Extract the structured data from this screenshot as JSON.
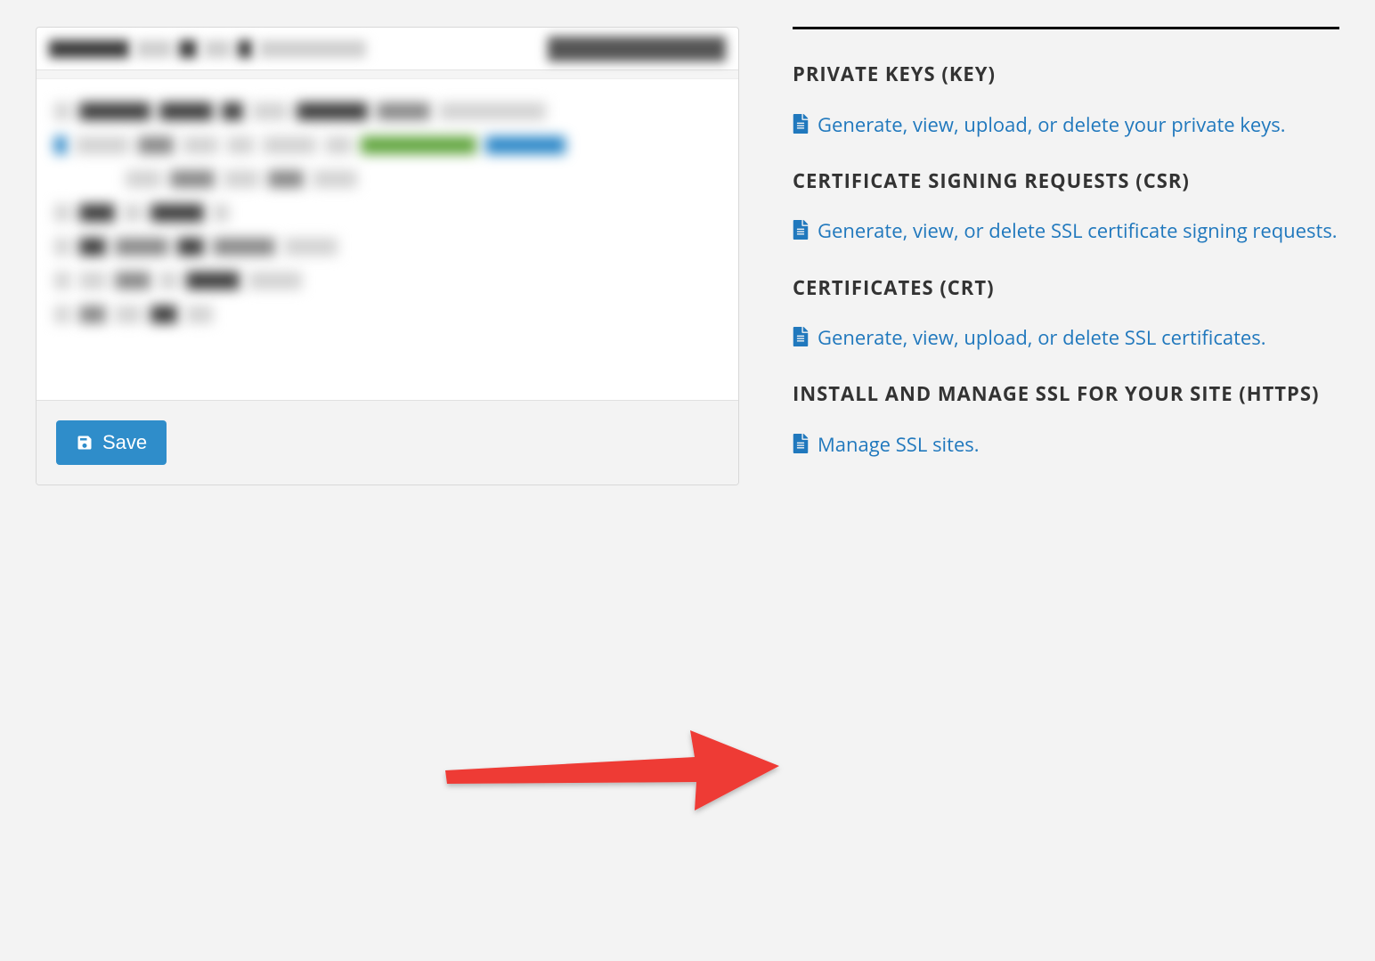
{
  "toolbar": {
    "save_label": "Save"
  },
  "sidebar": {
    "sections": [
      {
        "heading": "PRIVATE KEYS (KEY)",
        "link_text": "Generate, view, upload, or delete your private keys."
      },
      {
        "heading": "CERTIFICATE SIGNING REQUESTS (CSR)",
        "link_text": "Generate, view, or delete SSL certificate signing requests."
      },
      {
        "heading": "CERTIFICATES (CRT)",
        "link_text": "Generate, view, upload, or delete SSL certificates."
      },
      {
        "heading": "INSTALL AND MANAGE SSL FOR YOUR SITE (HTTPS)",
        "link_text": "Manage SSL sites."
      }
    ]
  },
  "annotation": {
    "type": "arrow",
    "color": "#ee3a36",
    "points_to": "sidebar.sections.3.link"
  }
}
